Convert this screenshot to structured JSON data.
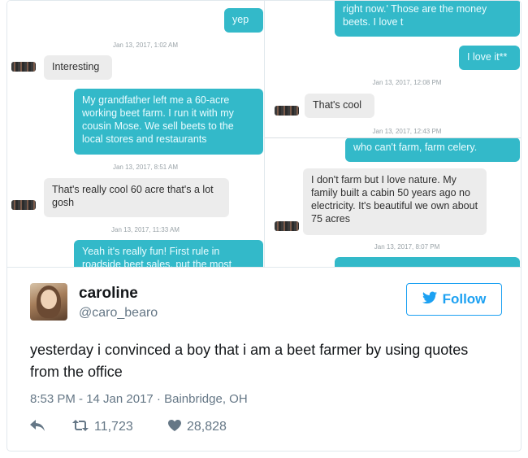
{
  "left_panel": {
    "msg1": "yep",
    "ts1": "Jan 13, 2017, 1:02 AM",
    "msg2": "Interesting",
    "msg3": "My grandfather left me a 60-acre working beet farm. I run it with my cousin Mose. We sell beets to the local stores and restaurants",
    "ts2": "Jan 13, 2017, 8:51 AM",
    "msg4": "That's really cool 60 acre that's a lot gosh",
    "ts3": "Jan 13, 2017, 11:33 AM",
    "msg5": "Yeah it's really fun! First rule in roadside beet sales, put the most"
  },
  "right_top": {
    "msg1": "right now.' Those are the money beets. I love t",
    "msg2": "I love it**",
    "ts1": "Jan 13, 2017, 12:08 PM",
    "msg3": "That's cool",
    "ts2": "Jan 13, 2017, 12:43 PM"
  },
  "right_bottom": {
    "msg1": "who can't farm, farm celery.",
    "msg2": "I don't farm but I love nature. My family built a cabin 50 years ago no electricity. It's beautiful we own about 75 acres",
    "ts1": "Jan 13, 2017, 8:07 PM"
  },
  "tweet": {
    "name": "caroline",
    "handle": "@caro_bearo",
    "follow_label": "Follow",
    "text": "yesterday i convinced a boy that i am a beet farmer by using quotes from the office",
    "meta": "8:53 PM - 14 Jan 2017 · Bainbridge, OH",
    "retweets": "11,723",
    "likes": "28,828"
  },
  "colors": {
    "accent": "#1da1f2",
    "outgoing_bubble": "#33b9c9",
    "incoming_bubble": "#ececec"
  },
  "icons": [
    "reply-icon",
    "retweet-icon",
    "heart-icon",
    "twitter-bird-icon"
  ]
}
